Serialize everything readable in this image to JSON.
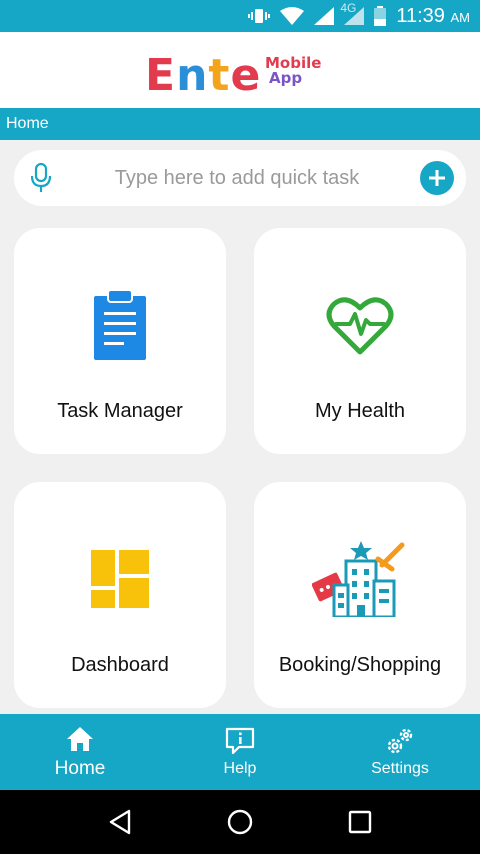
{
  "status_bar": {
    "time": "11:39",
    "ampm": "AM",
    "network": "4G",
    "icons": [
      "vibrate-icon",
      "wifi-icon",
      "signal-icon",
      "signal-4g-icon",
      "battery-icon"
    ]
  },
  "header": {
    "logo_main": [
      "E",
      "n",
      "t",
      "e"
    ],
    "logo_sub_1": "Mobile",
    "logo_sub_2": "App"
  },
  "breadcrumb": "Home",
  "quick_task": {
    "placeholder": "Type here to add quick task",
    "mic_icon": "microphone-icon",
    "add_icon": "plus-circle-icon"
  },
  "cards": [
    {
      "label": "Task Manager",
      "icon": "clipboard-icon"
    },
    {
      "label": "My Health",
      "icon": "heart-pulse-icon"
    },
    {
      "label": "Dashboard",
      "icon": "dashboard-tiles-icon"
    },
    {
      "label": "Booking/Shopping",
      "icon": "building-ticket-icon"
    }
  ],
  "bottom_nav": [
    {
      "label": "Home",
      "icon": "home-icon"
    },
    {
      "label": "Help",
      "icon": "help-info-icon"
    },
    {
      "label": "Settings",
      "icon": "gears-icon"
    }
  ],
  "colors": {
    "accent": "#16a6c6",
    "clipboard": "#1e88e5",
    "heart": "#34a83a",
    "dashboard": "#f9c20a"
  }
}
